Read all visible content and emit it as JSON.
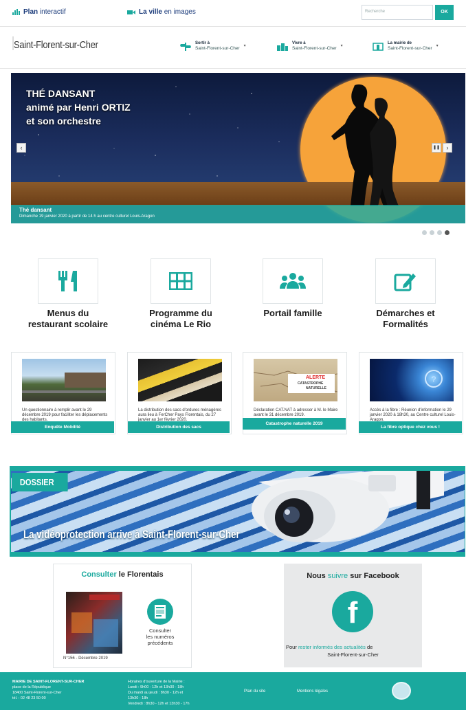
{
  "colors": {
    "accent": "#1aa99e",
    "navy": "#1a3a7a"
  },
  "topbar": {
    "plan_label": "Plan",
    "plan_suffix": "interactif",
    "ville_label": "La ville",
    "ville_suffix": "en images",
    "search_placeholder": "Recherche",
    "ok_label": "OK"
  },
  "header": {
    "logo_text": "Saint-Florent-sur-Cher",
    "nav": [
      {
        "title": "Sortir à",
        "subtitle": "Saint-Florent-sur-Cher",
        "icon": "signpost-icon"
      },
      {
        "title": "Vivre à",
        "subtitle": "Saint-Florent-sur-Cher",
        "icon": "town-icon"
      },
      {
        "title": "La mairie de",
        "subtitle": "Saint-Florent-sur-Cher",
        "icon": "town-hall-icon"
      }
    ]
  },
  "slider": {
    "headline_1": "THÉ DANSANT",
    "headline_2": "animé par Henri ORTIZ",
    "headline_3": "et son orchestre",
    "caption_title": "Thé dansant",
    "caption_text": "Dimanche 19 janvier 2020 à partir de 14 h au centre culturel Louis-Aragon",
    "prev_label": "‹",
    "next_label": "›",
    "pause_label": "❚❚",
    "dots_count": 4,
    "active_dot": 4
  },
  "quick_links": [
    {
      "label_1": "Menus du",
      "label_2": "restaurant scolaire",
      "icon": "cutlery-icon"
    },
    {
      "label_1": "Programme du",
      "label_2": "cinéma Le Rio",
      "icon": "film-icon"
    },
    {
      "label_1": "Portail famille",
      "label_2": "",
      "icon": "family-icon"
    },
    {
      "label_1": "Démarches et",
      "label_2": "Formalités",
      "icon": "edit-icon"
    }
  ],
  "news": [
    {
      "text": "Un questionnaire à remplir avant le 29 décembre 2019 pour faciliter les déplacements des habitants.",
      "button": "Enquête Mobilité"
    },
    {
      "text": "La distribution des sacs d'ordures ménagères aura lieu à FerCher Pays Florentais, du 27 janvier au 1er février 2020.",
      "button": "Distribution des sacs"
    },
    {
      "text": "Déclaration CAT.NAT à adresser à M. le Maire avant le 31 décembre 2019.",
      "button": "Catastrophe naturelle 2019"
    },
    {
      "text": "Accès à la fibre : Réunion d'information le 29 janvier 2020 à 18h30, au Centre culturel Louis-Aragon.",
      "button": "La fibre optique chez vous !"
    }
  ],
  "alert_image": {
    "line1": "ALERTE",
    "line2": "CATASTROPHE",
    "line3": "NATURELLE"
  },
  "dossier": {
    "tag": "DOSSIER",
    "headline": "La vidéoprotection arrive à Saint-Florent-sur-Cher"
  },
  "florentais": {
    "title_accent": "Consulter",
    "title_rest": "le Florentais",
    "issue_caption": "N°156 - Décembre 2019",
    "prev_1": "Consulter",
    "prev_2": "les numéros",
    "prev_3": "précédents"
  },
  "facebook": {
    "title_start": "Nous",
    "title_accent": "suivre",
    "title_end": "sur Facebook",
    "line_start": "Pour",
    "line_accent": "rester informés des actualités",
    "line_end": "de",
    "line_2": "Saint-Florent-sur-Cher"
  },
  "footer": {
    "org": "MAIRIE DE SAINT-FLORENT-SUR-CHER",
    "addr1": "place de la République",
    "addr2": "18400 Saint-Florent-sur-Cher",
    "tel": "tél. : 02 48 23 50 00",
    "hours_title": "Horaires d'ouverture de la Mairie :",
    "hours_1": "Lundi : 9h00 - 12h et 13h30 - 18h",
    "hours_2": "Du mardi au jeudi : 8h30 - 12h et",
    "hours_3": "13h30 - 18h",
    "hours_4": "Vendredi : 8h30 - 12h et 13h30 - 17h",
    "plan_site": "Plan du site",
    "mentions": "Mentions légales"
  }
}
